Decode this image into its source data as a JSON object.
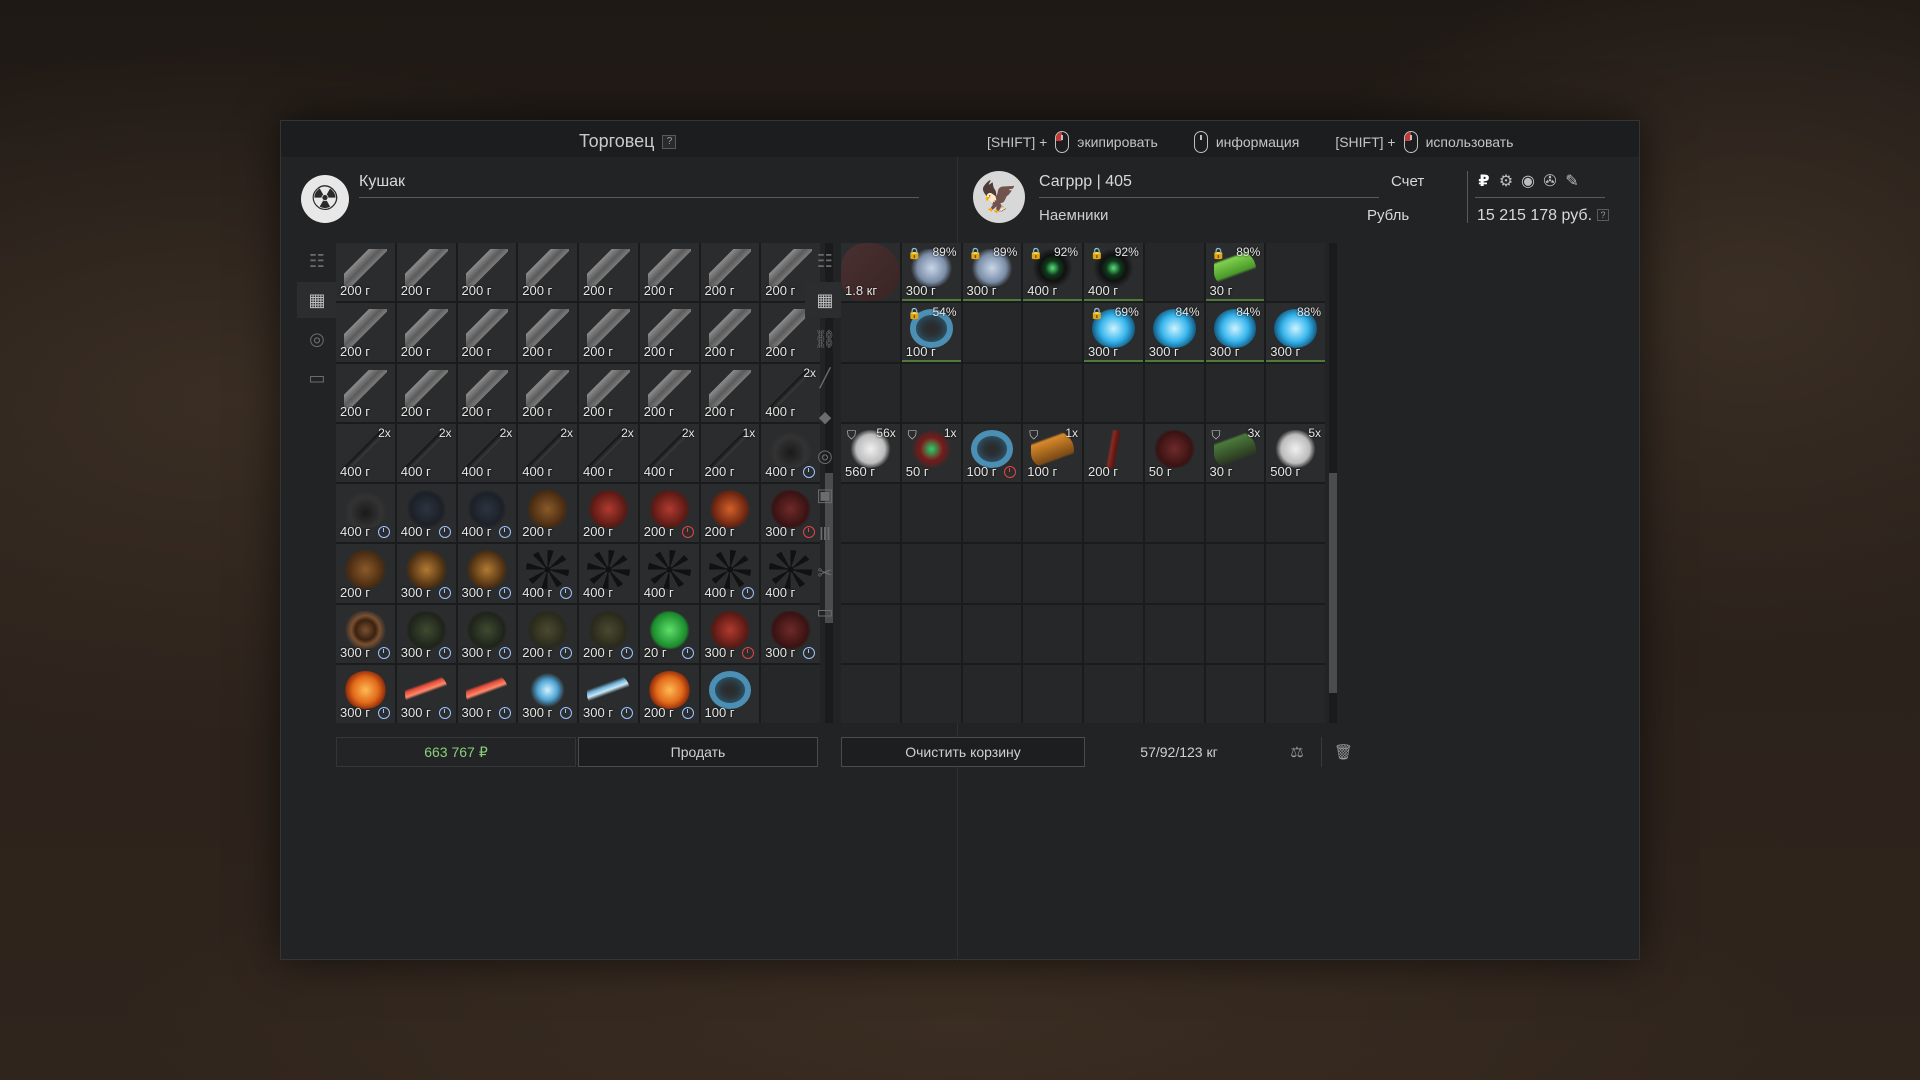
{
  "header": {
    "title": "Торговец",
    "help": "?",
    "hints": [
      {
        "prefix": "[SHIFT] +",
        "label": "экипировать",
        "mouse": "left"
      },
      {
        "prefix": "",
        "label": "информация",
        "mouse": "none"
      },
      {
        "prefix": "[SHIFT] +",
        "label": "использовать",
        "mouse": "left"
      }
    ]
  },
  "trader": {
    "icon": "radiation-icon",
    "name": "Кушак",
    "tabs": [
      "sort-icon",
      "grid-icon",
      "artifact-icon",
      "box-icon"
    ],
    "items": [
      {
        "icon": "gun",
        "price": "200 г"
      },
      {
        "icon": "gun",
        "price": "200 г"
      },
      {
        "icon": "gun",
        "price": "200 г"
      },
      {
        "icon": "gun",
        "price": "200 г"
      },
      {
        "icon": "gun",
        "price": "200 г"
      },
      {
        "icon": "gun",
        "price": "200 г"
      },
      {
        "icon": "gun",
        "price": "200 г"
      },
      {
        "icon": "gun",
        "price": "200 г"
      },
      {
        "icon": "gun",
        "price": "200 г"
      },
      {
        "icon": "gun",
        "price": "200 г"
      },
      {
        "icon": "gun",
        "price": "200 г"
      },
      {
        "icon": "gun",
        "price": "200 г"
      },
      {
        "icon": "gun",
        "price": "200 г"
      },
      {
        "icon": "gun",
        "price": "200 г"
      },
      {
        "icon": "gun",
        "price": "200 г"
      },
      {
        "icon": "gun",
        "price": "200 г"
      },
      {
        "icon": "gun",
        "price": "200 г"
      },
      {
        "icon": "gun",
        "price": "200 г"
      },
      {
        "icon": "gun",
        "price": "200 г"
      },
      {
        "icon": "gun",
        "price": "200 г"
      },
      {
        "icon": "gun",
        "price": "200 г"
      },
      {
        "icon": "gun",
        "price": "200 г"
      },
      {
        "icon": "gun",
        "price": "200 г"
      },
      {
        "icon": "blade",
        "price": "400 г",
        "qty": "2x"
      },
      {
        "icon": "blade",
        "price": "400 г",
        "qty": "2x"
      },
      {
        "icon": "blade",
        "price": "400 г",
        "qty": "2x"
      },
      {
        "icon": "blade",
        "price": "400 г",
        "qty": "2x"
      },
      {
        "icon": "blade",
        "price": "400 г",
        "qty": "2x"
      },
      {
        "icon": "blade",
        "price": "400 г",
        "qty": "2x"
      },
      {
        "icon": "blade",
        "price": "400 г",
        "qty": "2x"
      },
      {
        "icon": "blade",
        "price": "200 г",
        "qty": "1x"
      },
      {
        "icon": "claw",
        "price": "400 г",
        "timer": "blue"
      },
      {
        "icon": "claw",
        "price": "400 г",
        "timer": "blue"
      },
      {
        "icon": "dark",
        "price": "400 г",
        "timer": "blue"
      },
      {
        "icon": "dark",
        "price": "400 г",
        "timer": "blue"
      },
      {
        "icon": "brown",
        "price": "200 г"
      },
      {
        "icon": "red",
        "price": "200 г"
      },
      {
        "icon": "red",
        "price": "200 г",
        "timer": "red"
      },
      {
        "icon": "orange",
        "price": "200 г"
      },
      {
        "icon": "maroon",
        "price": "300 г",
        "timer": "red"
      },
      {
        "icon": "brown",
        "price": "200 г"
      },
      {
        "icon": "amber",
        "price": "300 г",
        "timer": "blue"
      },
      {
        "icon": "amber",
        "price": "300 г",
        "timer": "blue"
      },
      {
        "icon": "star",
        "price": "400 г",
        "timer": "blue"
      },
      {
        "icon": "star",
        "price": "400 г"
      },
      {
        "icon": "star",
        "price": "400 г"
      },
      {
        "icon": "star",
        "price": "400 г",
        "timer": "blue"
      },
      {
        "icon": "star",
        "price": "400 г"
      },
      {
        "icon": "swirl",
        "price": "300 г",
        "timer": "blue"
      },
      {
        "icon": "mossy",
        "price": "300 г",
        "timer": "blue"
      },
      {
        "icon": "mossy",
        "price": "300 г",
        "timer": "blue"
      },
      {
        "icon": "olive",
        "price": "200 г",
        "timer": "blue"
      },
      {
        "icon": "olive",
        "price": "200 г",
        "timer": "blue"
      },
      {
        "icon": "green",
        "price": "20 г",
        "timer": "blue"
      },
      {
        "icon": "red",
        "price": "300 г",
        "timer": "red"
      },
      {
        "icon": "maroon",
        "price": "300 г",
        "timer": "blue"
      },
      {
        "icon": "fire",
        "price": "300 г",
        "timer": "blue"
      },
      {
        "icon": "crystal",
        "price": "300 г",
        "timer": "blue"
      },
      {
        "icon": "crystal",
        "price": "300 г",
        "timer": "blue"
      },
      {
        "icon": "spark",
        "price": "300 г",
        "timer": "blue"
      },
      {
        "icon": "shard",
        "price": "300 г",
        "timer": "blue"
      },
      {
        "icon": "fire",
        "price": "200 г",
        "timer": "blue"
      },
      {
        "icon": "ring",
        "price": "100 г"
      },
      {
        "icon": "",
        "price": ""
      }
    ],
    "total": "663 767",
    "currency_sign": "₽",
    "sell_button": "Продать"
  },
  "player": {
    "icon": "eagle-icon",
    "name": "Сагррр | 405",
    "faction": "Наемники",
    "account_label": "Счет",
    "currency_label": "Рубль",
    "balance": "15 215 178 руб.",
    "currency_icons": [
      "₽",
      "⚙",
      "◉",
      "✇",
      "✎"
    ],
    "tabs": [
      "sort-icon",
      "grid-icon",
      "link-icon",
      "rifle-icon",
      "ammo-icon",
      "artifact-icon",
      "medkit-icon",
      "bars-icon",
      "tools-icon",
      "box-icon"
    ],
    "items": [
      {
        "icon": "bag",
        "weight": "1.8 кг"
      },
      {
        "icon": "ice",
        "price": "300 г",
        "pct": "89%",
        "lock": true
      },
      {
        "icon": "ice",
        "price": "300 г",
        "pct": "89%",
        "lock": true
      },
      {
        "icon": "greenstar",
        "price": "400 г",
        "pct": "92%",
        "lock": true
      },
      {
        "icon": "greenstar",
        "price": "400 г",
        "pct": "92%",
        "lock": true
      },
      {
        "icon": "",
        "price": ""
      },
      {
        "icon": "leaf",
        "price": "30 г",
        "pct": "89%",
        "lock": true
      },
      {
        "icon": "",
        "price": ""
      },
      {
        "icon": "",
        "price": ""
      },
      {
        "icon": "ring",
        "price": "100 г",
        "pct": "54%",
        "lock": true
      },
      {
        "icon": "",
        "price": ""
      },
      {
        "icon": "",
        "price": ""
      },
      {
        "icon": "blue",
        "price": "300 г",
        "pct": "69%",
        "lock": true
      },
      {
        "icon": "blue",
        "price": "300 г",
        "pct": "84%"
      },
      {
        "icon": "blue",
        "price": "300 г",
        "pct": "84%"
      },
      {
        "icon": "blue",
        "price": "300 г",
        "pct": "88%"
      },
      {
        "icon": "",
        "price": ""
      },
      {
        "icon": "",
        "price": ""
      },
      {
        "icon": "",
        "price": ""
      },
      {
        "icon": "",
        "price": ""
      },
      {
        "icon": "",
        "price": ""
      },
      {
        "icon": "",
        "price": ""
      },
      {
        "icon": "",
        "price": ""
      },
      {
        "icon": "",
        "price": ""
      },
      {
        "icon": "cloud",
        "price": "560 г",
        "qty": "56x",
        "shield": true
      },
      {
        "icon": "redgreen",
        "price": "50 г",
        "qty": "1x",
        "shield": true
      },
      {
        "icon": "ring",
        "price": "100 г",
        "timer": "red"
      },
      {
        "icon": "orangebox",
        "price": "100 г",
        "qty": "1x",
        "shield": true
      },
      {
        "icon": "redtwig",
        "price": "200 г"
      },
      {
        "icon": "maroon",
        "price": "50 г"
      },
      {
        "icon": "greenbox",
        "price": "30 г",
        "qty": "3x",
        "shield": true
      },
      {
        "icon": "cloud",
        "price": "500 г",
        "qty": "5x"
      }
    ],
    "clear_button": "Очистить корзину",
    "weight": "57/92/123 кг"
  }
}
